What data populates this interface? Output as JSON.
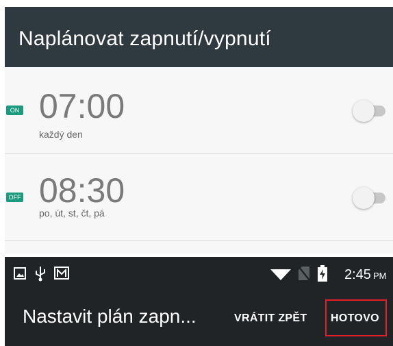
{
  "header": {
    "title": "Naplánovat zapnutí/vypnutí"
  },
  "schedules": [
    {
      "badge": "ON",
      "badge_color": "#1a9b7d",
      "time": "07:00",
      "repeat": "každý den",
      "enabled": false
    },
    {
      "badge": "OFF",
      "badge_color": "#1a9b7d",
      "time": "08:30",
      "repeat": "po, út, st, čt, pá",
      "enabled": false
    }
  ],
  "status_bar": {
    "left_icons": [
      "image-icon",
      "usb-icon",
      "gmail-icon"
    ],
    "right_icons": [
      "wifi-icon",
      "no-sim-icon",
      "battery-charging-icon"
    ],
    "time": "2:45",
    "ampm": "PM"
  },
  "bottom_bar": {
    "title": "Nastavit plán zapn...",
    "undo_label": "VRÁTIT ZPĚT",
    "done_label": "HOTOVO"
  },
  "colors": {
    "highlight": "#e2202b",
    "toolbar": "#2f3a40",
    "dark_bar": "#202426"
  }
}
